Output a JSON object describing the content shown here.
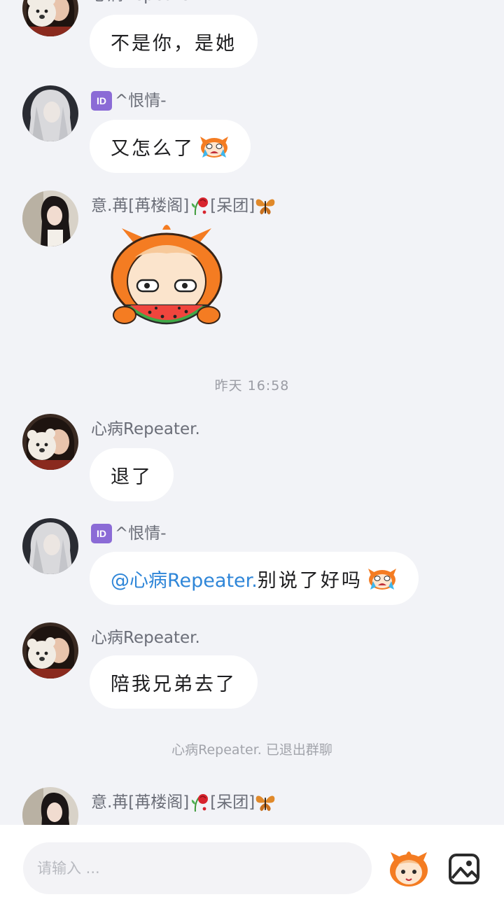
{
  "messages": [
    {
      "sender": "心病Repeater.",
      "text": "不是你，是她"
    },
    {
      "sender": "^恨情-",
      "badge": "ID",
      "text": "又怎么了",
      "emoji": "crying-cartoon-emoji"
    },
    {
      "sender": "意.苒[苒楼阁]",
      "sender_tail": "[呆团]",
      "decorations": [
        "wilted-rose-icon",
        "butterfly-icon"
      ],
      "sticker": "watermelon-eating-cartoon-sticker"
    },
    {
      "sender": "心病Repeater.",
      "text": "退了"
    },
    {
      "sender": "^恨情-",
      "badge": "ID",
      "mention": "@心病Repeater.",
      "text": "别说了好吗",
      "emoji": "crying-cartoon-emoji"
    },
    {
      "sender": "心病Repeater.",
      "text": "陪我兄弟去了"
    },
    {
      "sender": "意.苒[苒楼阁]",
      "sender_tail": "[呆团]",
      "decorations": [
        "wilted-rose-icon",
        "butterfly-icon"
      ]
    }
  ],
  "timestamp": "昨天 16:58",
  "system_notice": "心病Repeater. 已退出群聊",
  "input": {
    "placeholder": "请输入 ..."
  },
  "icons": {
    "sticker_button": "sticker-face-icon",
    "image_button": "image-icon"
  },
  "colors": {
    "background": "#f2f3f7",
    "bubble": "#ffffff",
    "mention": "#2f86d8",
    "badge": "#8b6bd6",
    "sticker_orange": "#f47c22"
  }
}
